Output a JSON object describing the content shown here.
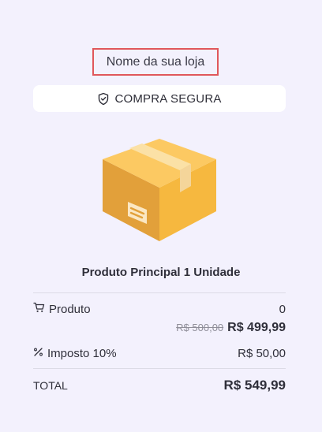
{
  "store": {
    "name": "Nome da sua loja"
  },
  "badge": {
    "label": "COMPRA SEGURA",
    "icon": "shield-check-icon"
  },
  "product": {
    "title": "Produto Principal 1 Unidade",
    "image": "package-box-icon"
  },
  "summary": {
    "product": {
      "label": "Produto",
      "icon": "cart-icon",
      "quantity": "0",
      "old_price": "R$ 500,00",
      "price": "R$ 499,99"
    },
    "tax": {
      "label": "Imposto 10%",
      "icon": "percent-icon",
      "value": "R$ 50,00"
    },
    "total": {
      "label": "TOTAL",
      "value": "R$ 549,99"
    }
  },
  "colors": {
    "background": "#f3f1fd",
    "highlight_border": "#e0575b",
    "box": "#f5b43c"
  }
}
